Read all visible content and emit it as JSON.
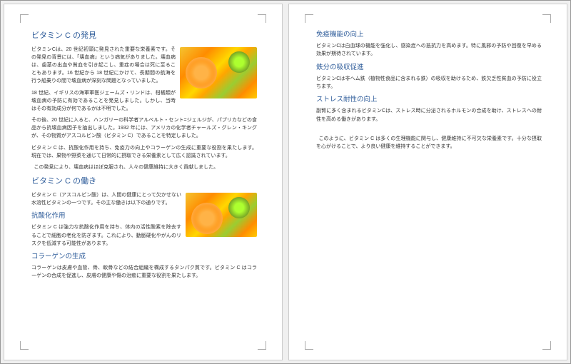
{
  "page1": {
    "h1": "ビタミン C の発見",
    "p1": "ビタミンCは、20 世紀初頭に発見された重要な栄養素です。その発見の背景には、「壊血病」という病気がありました。壊血病は、歯茎の出血や貧血を引き起こし、重症の場合は死に至ることもあります。16 世紀から 18 世紀にかけて、長期間の航海を行う船乗りの間で壊血病が深刻な問題となっていました。",
    "p2": "18 世紀、イギリスの海軍軍医ジェームズ・リンドは、柑橘類が壊血病の予防に有効であることを発見しました。しかし、当時はその有効成分が何であるかは不明でした。",
    "p3": "その後、20 世紀に入ると、ハンガリーの科学者アルベルト・セント=ジェルジが、パプリカなどの食品から抗壊血病因子を抽出しました。1932 年には、アメリカの化学者チャールズ・グレン・キングが、その物質がアスコルビン酸（ビタミン C）であることを特定しました。",
    "p4": "ビタミン C は、抗酸化作用を持ち、免疫力の向上やコラーゲンの生成に重要な役割を果たします。現在では、果物や野菜を通じて日常的に摂取できる栄養素として広く認識されています。",
    "p5": "この発見により、壊血病はほぼ克服され、人々の健康維持に大きく貢献しました。",
    "h2": "ビタミン C の働き",
    "p6": "ビタミン C（アスコルビン酸）は、人間の健康にとって欠かせない水溶性ビタミンの一つです。その主な働きは以下の通りです。",
    "h3a": "抗酸化作用",
    "p7": "ビタミン C は強力な抗酸化作用を持ち、体内の活性酸素を除去することで細胞の老化を防ぎます。これにより、動脈硬化やがんのリスクを低減する可能性があります。",
    "h3b": "コラーゲンの生成",
    "p8": "コラーゲンは皮膚や血管、骨、軟骨などの結合組織を構成するタンパク質です。ビタミン C はコラーゲンの合成を促進し、皮膚の健康や傷の治癒に重要な役割を果たします。"
  },
  "page2": {
    "h3a": "免疫機能の向上",
    "p1": "ビタミンCは白血球の機能を強化し、感染症への抵抗力を高めます。特に風邪の予防や回復を早める効果が期待されています。",
    "h3b": "鉄分の吸収促進",
    "p2": "ビタミンCは非ヘム鉄（植物性食品に含まれる鉄）の吸収を助けるため、鉄欠乏性貧血の予防に役立ちます。",
    "h3c": "ストレス耐性の向上",
    "p3": "副腎に多く含まれるビタミンCは、ストレス時に分泌されるホルモンの合成を助け、ストレスへの耐性を高める働きがあります。",
    "p4": "このように、ビタミン C は多くの生理機能に関与し、健康維持に不可欠な栄養素です。十分な摂取を心がけることで、より良い健康を維持することができます。"
  }
}
